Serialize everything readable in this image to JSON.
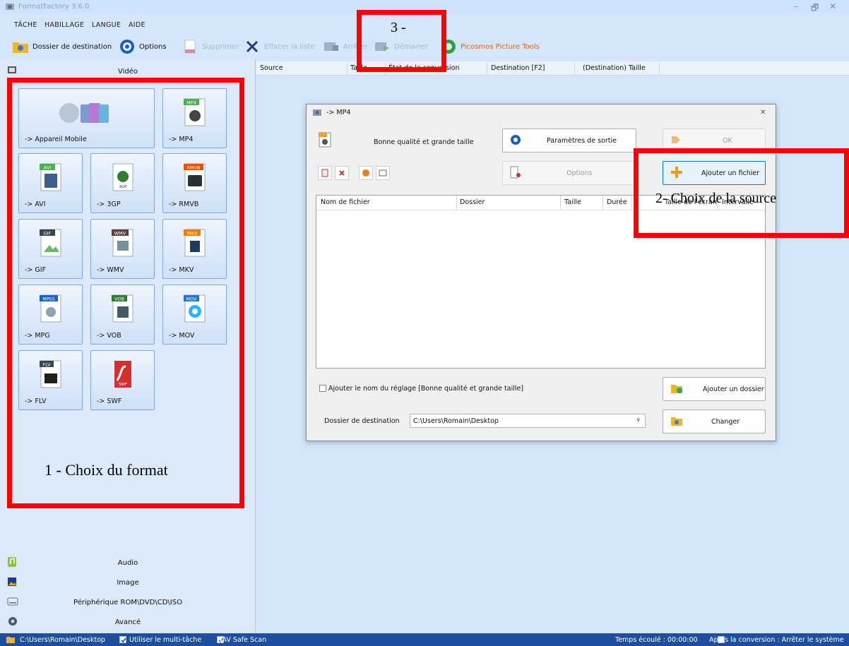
{
  "app": {
    "title": "FormatFactory 3.6.0",
    "win_min": "–",
    "win_max": "🗗",
    "win_close": "✕"
  },
  "menu": [
    "TÂCHE",
    "HABILLAGE",
    "LANGUE",
    "AIDE"
  ],
  "toolbar": {
    "dest_folder": "Dossier de destination",
    "options": "Options",
    "delete": "Supprimer",
    "clear_list": "Effacer la liste",
    "stop": "Arrêter",
    "start": "Démarrer",
    "picosmos": "Picosmos Picture Tools",
    "picosmos_color": "#e8630a"
  },
  "sidebar": {
    "video_header": "Vidéo",
    "formats": [
      {
        "label": "-> Appareil Mobile",
        "badge": ""
      },
      {
        "label": "-> MP4",
        "badge": "MP4"
      },
      {
        "label": "-> AVI",
        "badge": "AVI"
      },
      {
        "label": "-> 3GP",
        "badge": "3GP"
      },
      {
        "label": "-> RMVB",
        "badge": "RMVB"
      },
      {
        "label": "-> GIF",
        "badge": "GIF"
      },
      {
        "label": "-> WMV",
        "badge": "WMV"
      },
      {
        "label": "-> MKV",
        "badge": "MKV"
      },
      {
        "label": "-> MPG",
        "badge": "MPEG"
      },
      {
        "label": "-> VOB",
        "badge": "VOB"
      },
      {
        "label": "-> MOV",
        "badge": "MOV"
      },
      {
        "label": "-> FLV",
        "badge": "FLV"
      },
      {
        "label": "-> SWF",
        "badge": "SWF"
      }
    ],
    "categories": [
      "Audio",
      "Image",
      "Périphérique ROM\\DVD\\CD\\ISO",
      "Avancé"
    ]
  },
  "columns": [
    "Source",
    "Taille",
    "État de la conversion",
    "Destination [F2]",
    "(Destination) Taille"
  ],
  "dialog": {
    "title": "-> MP4",
    "close": "✕",
    "quality": "Bonne qualité et grande taille",
    "output_settings": "Paramètres de sortie",
    "ok": "OK",
    "options": "Options",
    "add_file": "Ajouter un fichier",
    "list_columns": [
      "Nom de fichier",
      "Dossier",
      "Taille",
      "Durée",
      "Taille de l'écran",
      "Intervalle"
    ],
    "add_preset_name": "Ajouter le nom du réglage [Bonne qualité et grande taille]",
    "add_folder": "Ajouter un dossier",
    "dest_label": "Dossier de destination",
    "dest_value": "C:\\Users\\Romain\\Desktop",
    "change": "Changer"
  },
  "status": {
    "path": "C:\\Users\\Romain\\Desktop",
    "multitask": "Utiliser le multi-tâche",
    "bav": "BAV Safe Scan",
    "elapsed": "Temps écoulé : 00:00:00",
    "after": "Après la conversion : Arrêter le système"
  },
  "annotations": {
    "a1": "1 - Choix du format",
    "a2": "2- Choix de la source",
    "a3": "3 -",
    "color": "#ff0000"
  }
}
